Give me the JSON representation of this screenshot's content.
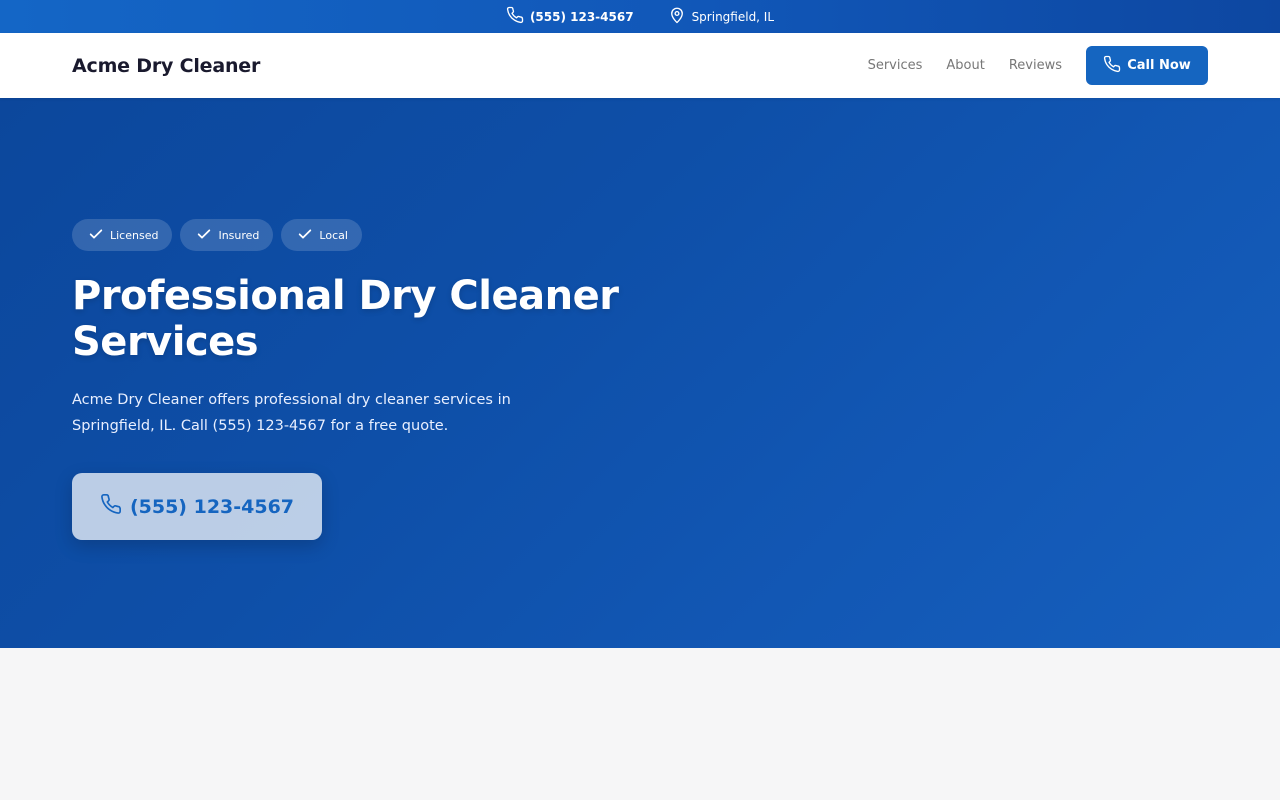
{
  "topbar": {
    "phone": "(555) 123-4567",
    "location": "Springfield, IL"
  },
  "nav": {
    "brand": "Acme Dry Cleaner",
    "links": [
      "Services",
      "About",
      "Reviews"
    ],
    "cta_label": "Call Now"
  },
  "hero": {
    "badges": [
      "Licensed",
      "Insured",
      "Local"
    ],
    "title": "Professional Dry Cleaner Services",
    "description": "Acme Dry Cleaner offers professional dry cleaner services in Springfield, IL. Call (555) 123-4567 for a free quote.",
    "cta_label": "(555) 123-4567"
  },
  "colors": {
    "brand_blue": "#1565c0",
    "hero_dark": "#0c479c",
    "page_bg": "#f6f6f7"
  },
  "icons": {
    "phone": "phone-icon",
    "location": "map-pin-icon",
    "check": "check-icon"
  }
}
